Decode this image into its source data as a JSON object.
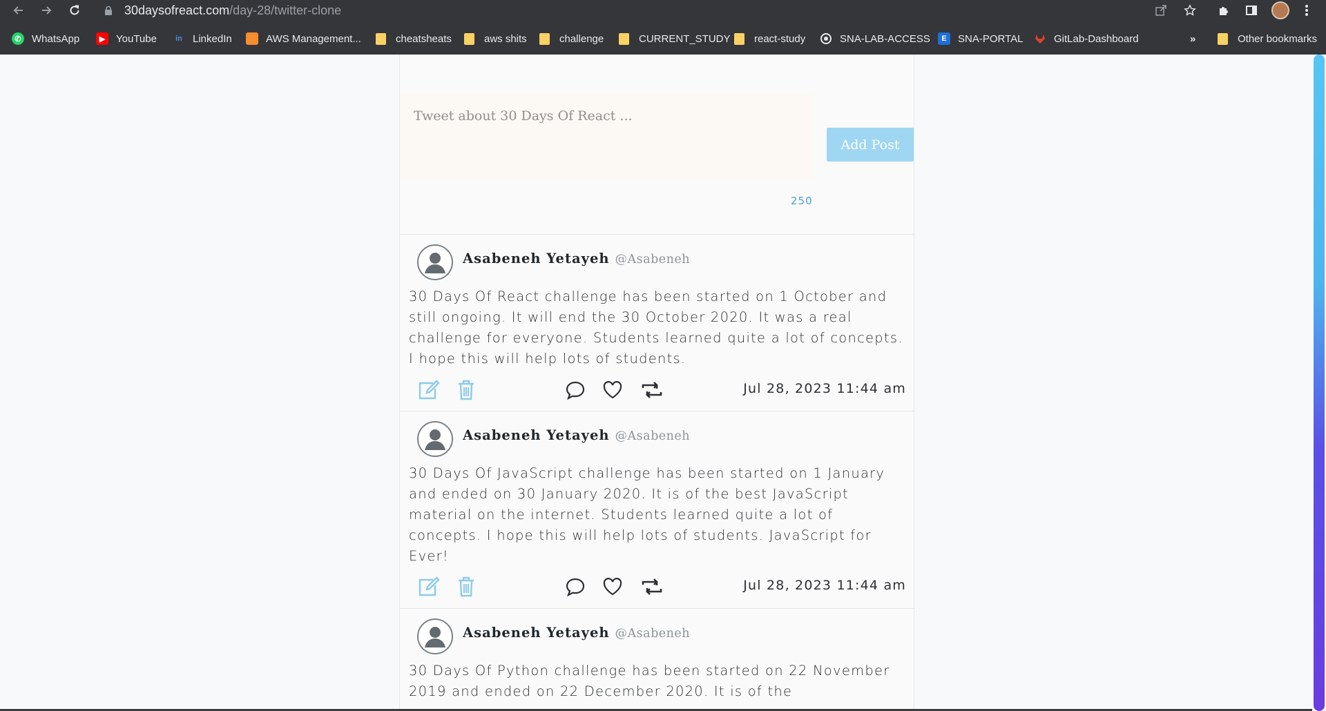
{
  "browser": {
    "url_host": "30daysofreact.com",
    "url_path": "/day-28/twitter-clone",
    "bookmarks": [
      {
        "label": "WhatsApp",
        "icon": "whatsapp-icon",
        "color": "#25d366"
      },
      {
        "label": "YouTube",
        "icon": "youtube-icon",
        "color": "#ff0000"
      },
      {
        "label": "LinkedIn",
        "icon": "linkedin-icon",
        "color": "#0a66c2"
      },
      {
        "label": "AWS Management...",
        "icon": "aws-icon",
        "color": "#f68d2e"
      },
      {
        "label": "cheatsheats",
        "icon": "folder-icon"
      },
      {
        "label": "aws shits",
        "icon": "folder-icon"
      },
      {
        "label": "challenge",
        "icon": "folder-icon"
      },
      {
        "label": "CURRENT_STUDY",
        "icon": "folder-icon"
      },
      {
        "label": "react-study",
        "icon": "folder-icon"
      },
      {
        "label": "SNA-LAB-ACCESS",
        "icon": "sna-lab-icon"
      },
      {
        "label": "SNA-PORTAL",
        "icon": "sna-portal-icon",
        "color": "#1e6fd9"
      },
      {
        "label": "GitLab-Dashboard",
        "icon": "gitlab-icon"
      }
    ],
    "overflow_label": "»",
    "other_bookmarks": "Other bookmarks"
  },
  "compose": {
    "placeholder": "Tweet about 30 Days Of React ...",
    "add_post_label": "Add Post",
    "char_count": "250"
  },
  "posts": [
    {
      "name": "Asabeneh Yetayeh",
      "handle": "@Asabeneh",
      "text": "30 Days Of React challenge has been started on 1 October and still ongoing. It will end the 30 October 2020. It was a real challenge for everyone. Students learned quite a lot of concepts. I hope this will help lots of students.",
      "timestamp": "Jul 28, 2023 11:44 am"
    },
    {
      "name": "Asabeneh Yetayeh",
      "handle": "@Asabeneh",
      "text": "30 Days Of JavaScript challenge has been started on 1 January and ended on 30 January 2020. It is of the best JavaScript material on the internet. Students learned quite a lot of concepts. I hope this will help lots of students. JavaScript for Ever!",
      "timestamp": "Jul 28, 2023 11:44 am"
    },
    {
      "name": "Asabeneh Yetayeh",
      "handle": "@Asabeneh",
      "text": "30 Days Of Python challenge has been started on 22 November 2019 and ended on 22 December 2020. It is of the"
    }
  ],
  "colors": {
    "accent": "#4a9fd0",
    "button": "#9fd6f2",
    "icon": "#8ccbea"
  }
}
